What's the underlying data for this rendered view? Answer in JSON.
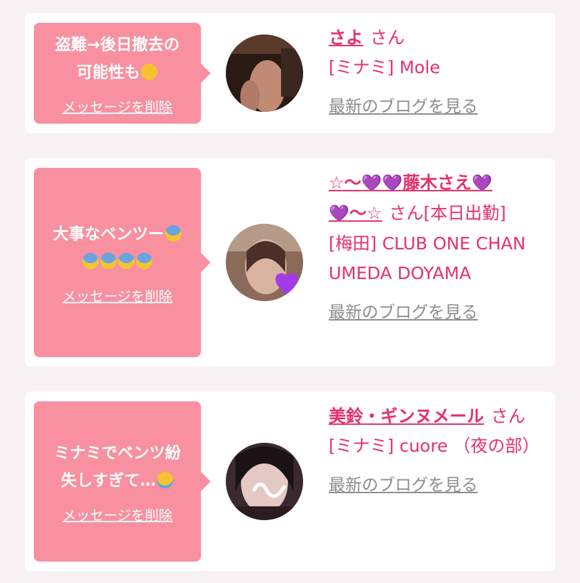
{
  "colors": {
    "accent": "#e8306a",
    "bubble": "#f8909f",
    "page_bg": "#f7f1f3",
    "link_gray": "#8d8d8d"
  },
  "cards": [
    {
      "message": "盗難→後日撤去の\n可能性も",
      "message_emoji": "thinking-face",
      "delete_label": "メッセージを削除",
      "name": "さよ",
      "honorific": "さん",
      "shop": "[ミナミ] Mole",
      "blog_label": "最新のブログを見る"
    },
    {
      "message": "大事なベンツー",
      "message_line2": "",
      "message_emoji": "face-screaming-in-fear",
      "delete_label": "メッセージを削除",
      "name_part1": "☆〜",
      "name_part2": "藤木さえ",
      "name_part3": "〜☆",
      "heart_symbol": "💜",
      "honorific": "さん[本日出勤]",
      "shop": "[梅田] CLUB ONE CHAN UMEDA DOYAMA",
      "blog_label": "最新のブログを見る"
    },
    {
      "message": "ミナミでベンツ紛\n失しすぎて…",
      "message_emoji": "loudly-crying-face",
      "delete_label": "メッセージを削除",
      "name": "美鈴・ギンヌメール",
      "honorific": "さん",
      "shop": "[ミナミ] cuore （夜の部）",
      "blog_label": "最新のブログを見る"
    }
  ]
}
